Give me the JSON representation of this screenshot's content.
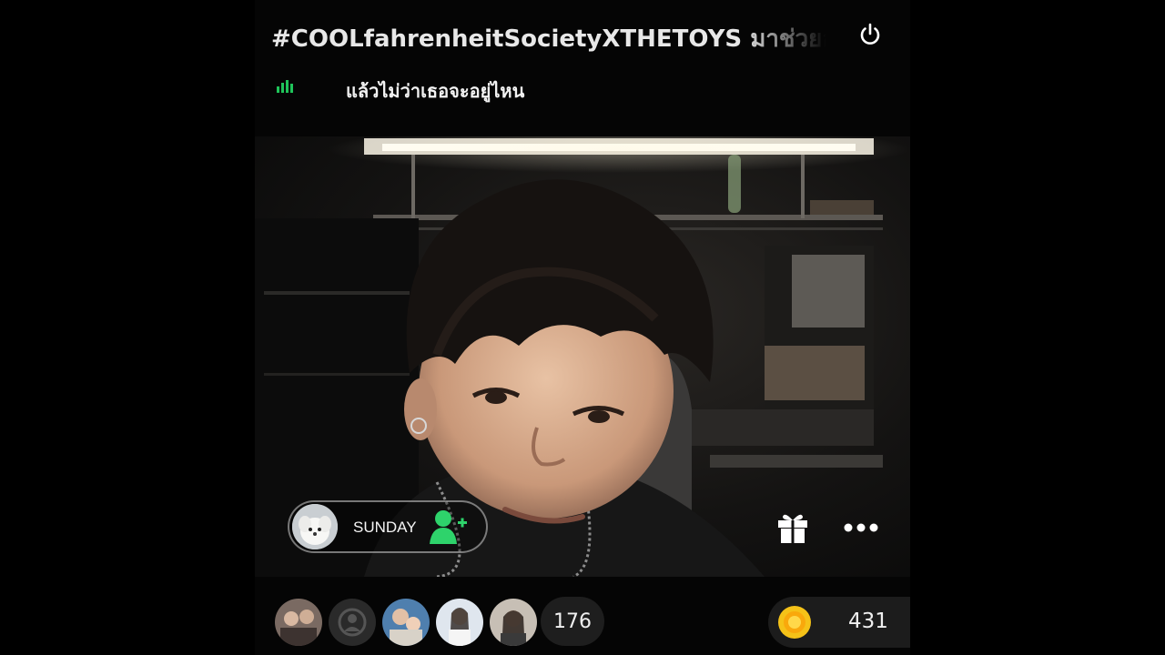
{
  "header": {
    "title": "#COOLfahrenheitSocietyXTHETOYS มาช่วยอา",
    "power_icon": "power-icon"
  },
  "now_playing": {
    "equalizer_icon": "equalizer-icon",
    "lyric": "แล้วไม่ว่าเธอจะอยู่ไหน",
    "equalizer_color": "#1fc45a"
  },
  "host": {
    "name": "SUNDAY",
    "follow_icon": "add-user-icon",
    "follow_color": "#2ed36b"
  },
  "actions": {
    "gift_icon": "gift-icon",
    "more_icon": "more-icon"
  },
  "viewers": {
    "avatars": [
      "viewer-avatar-1",
      "viewer-avatar-2",
      "viewer-avatar-3",
      "viewer-avatar-4",
      "viewer-avatar-5"
    ],
    "count": "176"
  },
  "coins": {
    "icon": "coin-icon",
    "count": "431",
    "coin_color": "#f5c218"
  }
}
